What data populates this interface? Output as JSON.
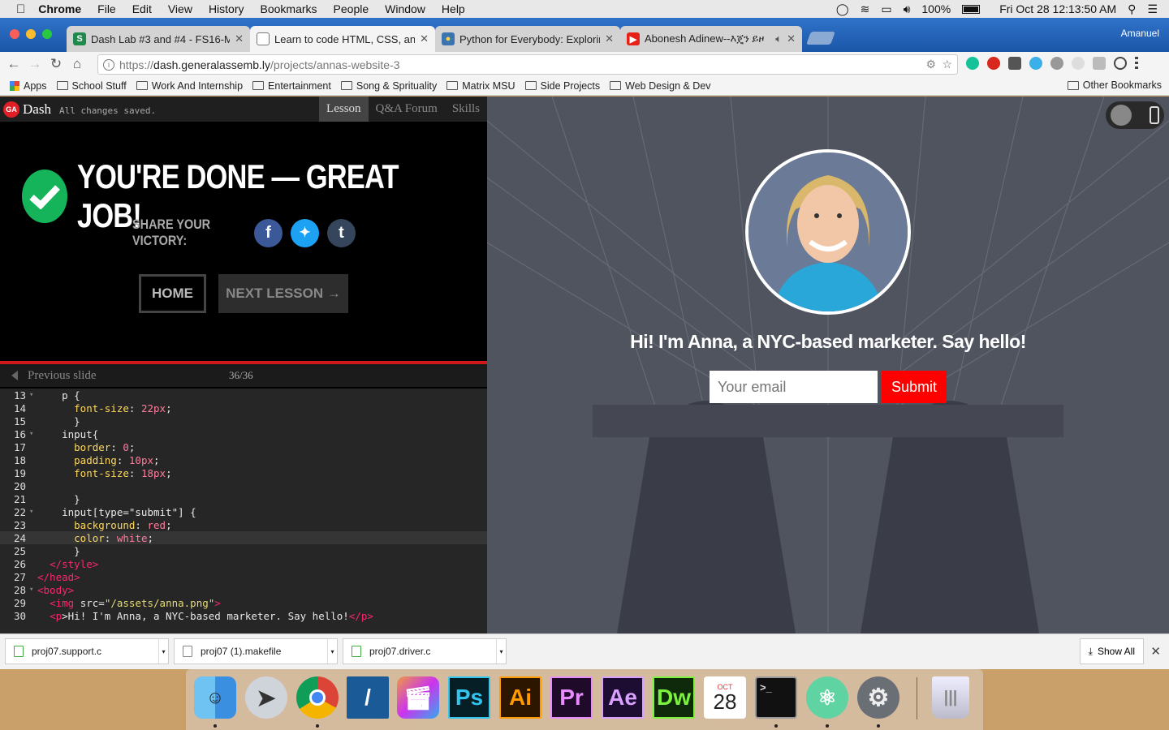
{
  "menubar": {
    "app": "Chrome",
    "items": [
      "File",
      "Edit",
      "View",
      "History",
      "Bookmarks",
      "People",
      "Window",
      "Help"
    ],
    "battery": "100%",
    "clock": "Fri Oct 28  12:13:50 AM"
  },
  "tabs": [
    {
      "title": "Dash Lab #3 and #4 - FS16-M",
      "favicon": "sheets-icon",
      "color": "#1f8a4c"
    },
    {
      "title": "Learn to code HTML, CSS, and",
      "favicon": "page-icon",
      "color": "#ffffff"
    },
    {
      "title": "Python for Everybody: Explorin",
      "favicon": "python-icon",
      "color": "#3b74b0"
    },
    {
      "title": "Abonesh Adinew--እጄን ይዞ",
      "favicon": "youtube-icon",
      "color": "#e62117"
    }
  ],
  "profile": "Amanuel",
  "omnibox": {
    "scheme": "https://",
    "host": "dash.generalassemb.ly",
    "path": "/projects/annas-website-3"
  },
  "bookmarks": {
    "apps": "Apps",
    "folders": [
      "School Stuff",
      "Work And Internship",
      "Entertainment",
      "Song & Sprituality",
      "Matrix MSU",
      "Side Projects",
      "Web Design & Dev"
    ],
    "other": "Other Bookmarks"
  },
  "dash": {
    "logo": "GA",
    "name": "Dash",
    "status": "All changes saved.",
    "tabs": [
      "Lesson",
      "Q&A Forum",
      "Skills"
    ],
    "done_title": "YOU'RE DONE — GREAT JOB!",
    "share_label": "SHARE YOUR VICTORY:",
    "home_label": "HOME",
    "next_label": "NEXT LESSON →",
    "prev_label": "Previous slide",
    "slide_count": "36/36",
    "progress": 1.0
  },
  "code": [
    {
      "n": "13",
      "fold": "▾",
      "t": "    p {"
    },
    {
      "n": "14",
      "fold": "",
      "t": "      font-size: 22px;"
    },
    {
      "n": "15",
      "fold": "",
      "t": "      }"
    },
    {
      "n": "16",
      "fold": "▾",
      "t": "    input{"
    },
    {
      "n": "17",
      "fold": "",
      "t": "      border: 0;"
    },
    {
      "n": "18",
      "fold": "",
      "t": "      padding: 10px;"
    },
    {
      "n": "19",
      "fold": "",
      "t": "      font-size: 18px;"
    },
    {
      "n": "20",
      "fold": "",
      "t": ""
    },
    {
      "n": "21",
      "fold": "",
      "t": "      }"
    },
    {
      "n": "22",
      "fold": "▾",
      "t": "    input[type=\"submit\"] {"
    },
    {
      "n": "23",
      "fold": "",
      "t": "      background: red;"
    },
    {
      "n": "24",
      "fold": "",
      "t": "      color: white;"
    },
    {
      "n": "25",
      "fold": "",
      "t": "      }"
    },
    {
      "n": "26",
      "fold": "",
      "t": "  </style>"
    },
    {
      "n": "27",
      "fold": "",
      "t": "</head>"
    },
    {
      "n": "28",
      "fold": "▾",
      "t": "<body>"
    },
    {
      "n": "29",
      "fold": "",
      "t": "  <img src=\"/assets/anna.png\">"
    },
    {
      "n": "30",
      "fold": "",
      "t": "  <p>Hi! I'm Anna, a NYC-based marketer. Say hello!</p>"
    }
  ],
  "preview": {
    "headline": "Hi! I'm Anna, a NYC-based marketer. Say hello!",
    "email_placeholder": "Your email",
    "submit_label": "Submit"
  },
  "downloads": {
    "files": [
      "proj07.support.c",
      "proj07 (1).makefile",
      "proj07.driver.c"
    ],
    "show_all": "Show All"
  },
  "dock": {
    "calendar_month": "OCT",
    "calendar_day": "28",
    "apps": [
      "finder-icon",
      "launchpad-icon",
      "chrome-icon",
      "zeplin-icon",
      "final-cut-icon",
      "photoshop-icon",
      "illustrator-icon",
      "premiere-icon",
      "after-effects-icon",
      "dreamweaver-icon",
      "calendar-icon",
      "terminal-icon",
      "atom-icon",
      "system-preferences-icon",
      "trash-icon"
    ]
  }
}
